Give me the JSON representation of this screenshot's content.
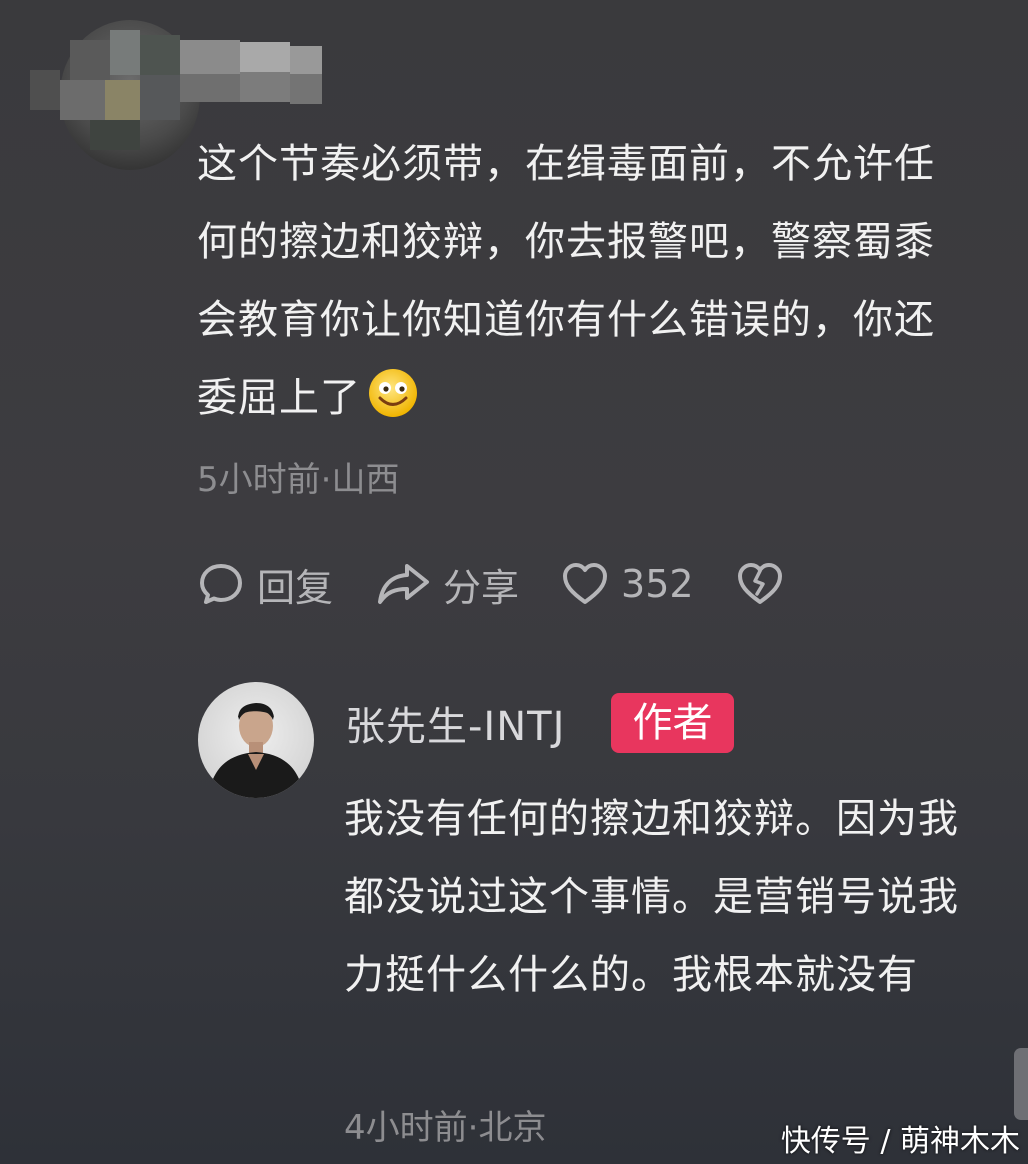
{
  "comment": {
    "text": "这个节奏必须带，在缉毒面前，不允许任何的擦边和狡辩，你去报警吧，警察蜀黍会教育你让你知道你有什么错误的，你还委屈上了",
    "emoji": "smiling-face-emoji",
    "meta": "5小时前·山西",
    "actions": {
      "reply_label": "回复",
      "share_label": "分享",
      "like_count": "352"
    }
  },
  "reply": {
    "author_name": "张先生-INTJ",
    "author_badge": "作者",
    "text": "我没有任何的擦边和狡辩。因为我都没说过这个事情。是营销号说我力挺什么什么的。我根本就没有",
    "meta": "4小时前·北京"
  },
  "watermark": "快传号 / 萌神木木",
  "colors": {
    "badge": "#e8365e",
    "background": "#3b3b3e",
    "meta_text": "#8d8d90"
  }
}
